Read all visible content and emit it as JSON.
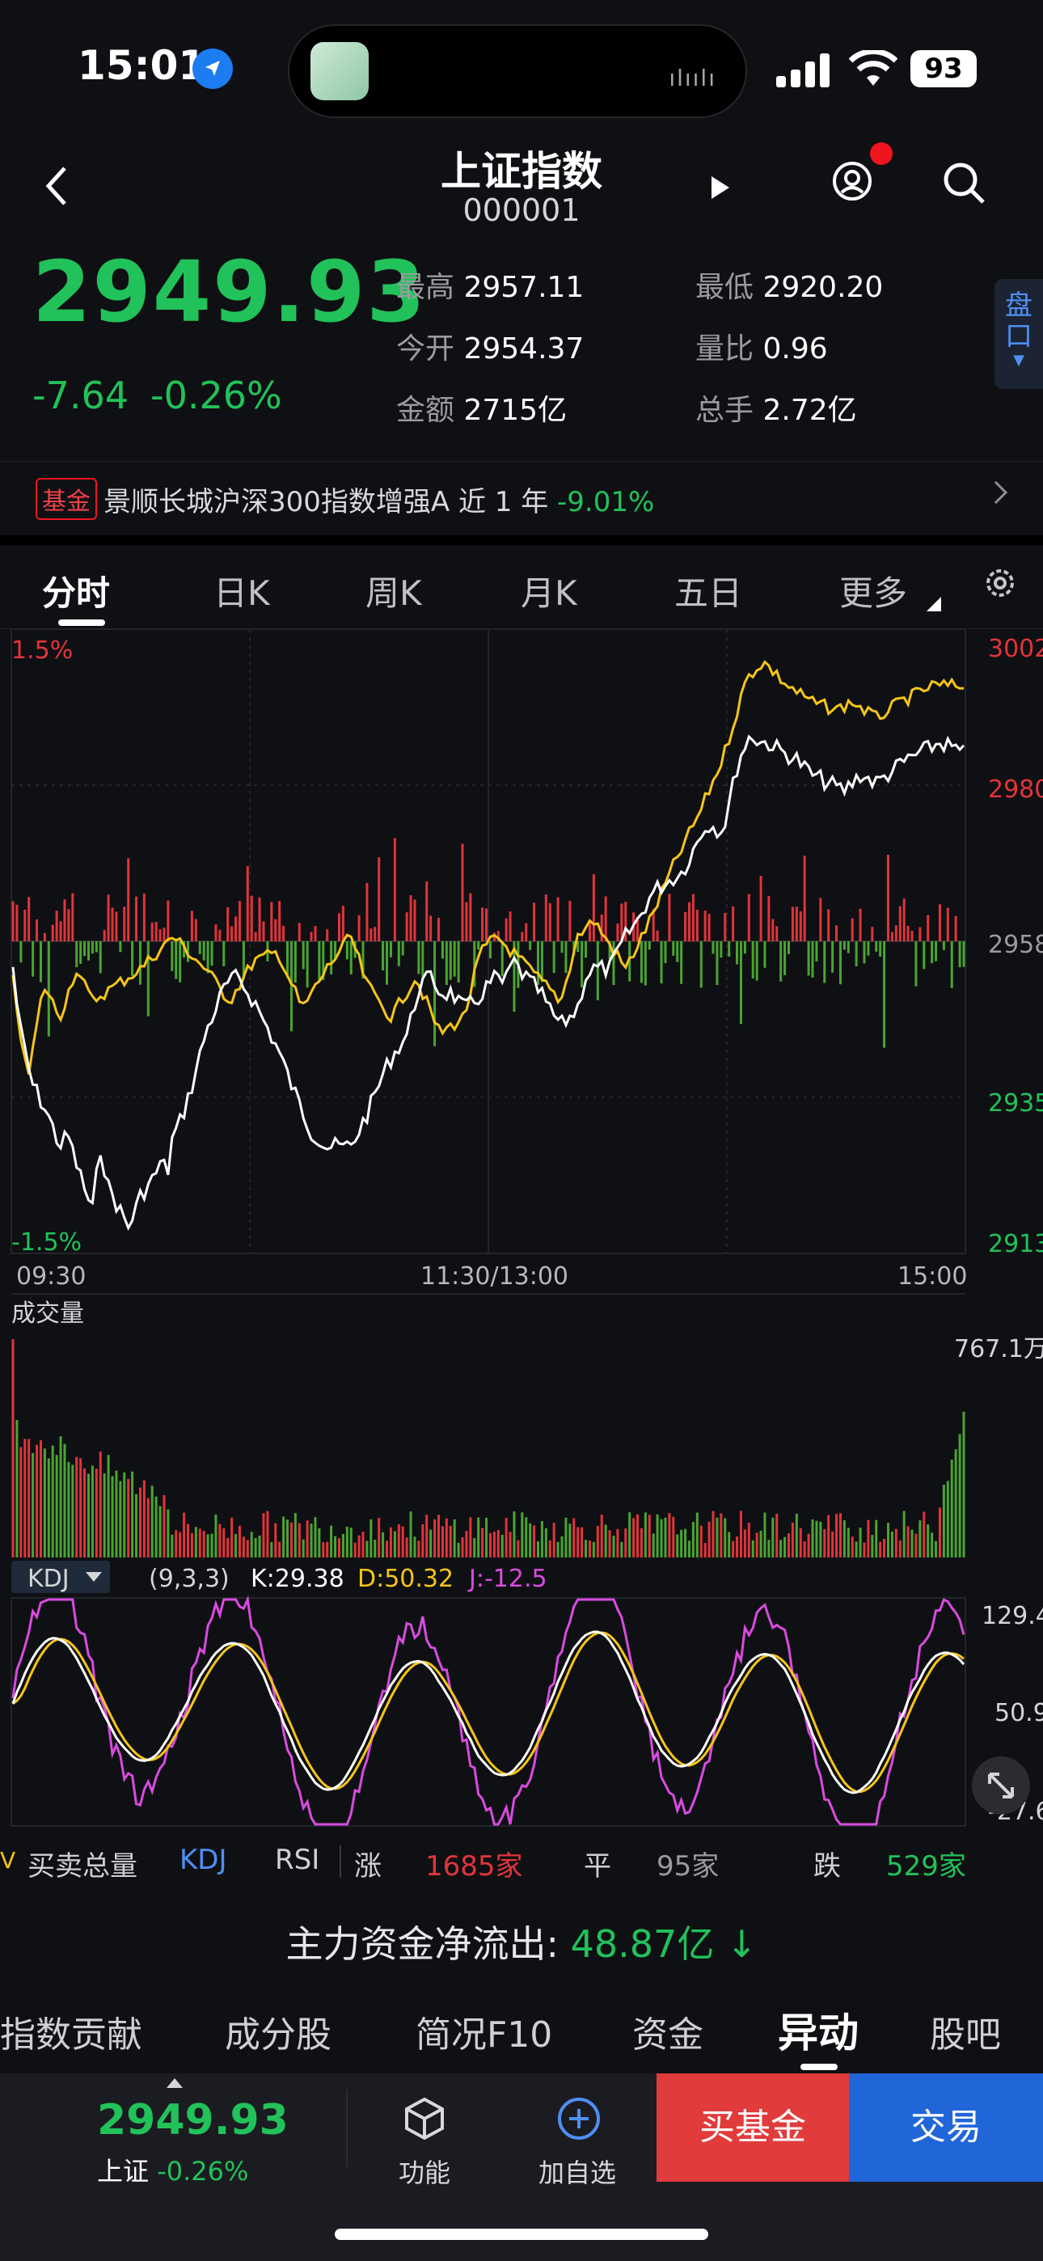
{
  "status": {
    "time": "15:01",
    "battery": "93"
  },
  "header": {
    "title": "上证指数",
    "code": "000001"
  },
  "quote": {
    "price": "2949.93",
    "change": "-7.64",
    "change_pct": "-0.26%",
    "stats": [
      {
        "label": "最高",
        "value": "2957.11"
      },
      {
        "label": "最低",
        "value": "2920.20"
      },
      {
        "label": "今开",
        "value": "2954.37"
      },
      {
        "label": "量比",
        "value": "0.96"
      },
      {
        "label": "金额",
        "value": "2715亿"
      },
      {
        "label": "总手",
        "value": "2.72亿"
      }
    ],
    "pankou": "盘口"
  },
  "fund": {
    "tag": "基金",
    "name": "景顺长城沪深300指数增强A",
    "period": "近 1 年",
    "pct": "-9.01%"
  },
  "chart_tabs": [
    "分时",
    "日K",
    "周K",
    "月K",
    "五日",
    "更多"
  ],
  "intraday": {
    "pct_top": "1.5%",
    "pct_bottom": "-1.5%",
    "right_labels": [
      "3002",
      "2980",
      "2958",
      "2935",
      "2913"
    ],
    "times": [
      "09:30",
      "11:30/13:00",
      "15:00"
    ]
  },
  "volume": {
    "label": "成交量",
    "max": "767.1万"
  },
  "kdj": {
    "name": "KDJ",
    "params": "(9,3,3)",
    "k": "K:29.38",
    "d": "D:50.32",
    "j": "J:-12.5",
    "right_labels": [
      "129.4",
      "50.9",
      "-27.6"
    ]
  },
  "bottom_stats": {
    "items": [
      "买卖总量",
      "KDJ",
      "RSI"
    ],
    "up_label": "涨",
    "up_val": "1685家",
    "flat_label": "平",
    "flat_val": "95家",
    "down_label": "跌",
    "down_val": "529家"
  },
  "flow": {
    "label": "主力资金净流出:",
    "value": "48.87亿"
  },
  "section_tabs": [
    "指数贡献",
    "成分股",
    "简况F10",
    "资金",
    "异动",
    "股吧"
  ],
  "bottom_bar": {
    "price": "2949.93",
    "name": "上证",
    "pct": "-0.26%",
    "func": "功能",
    "add": "加自选",
    "buy": "买基金",
    "trade": "交易"
  },
  "colors": {
    "up": "#e2343b",
    "down": "#21c25a",
    "avg": "#f5c518",
    "price_line": "#ffffff",
    "k": "#ffffff",
    "d": "#f5c518",
    "j": "#d94be0"
  }
}
